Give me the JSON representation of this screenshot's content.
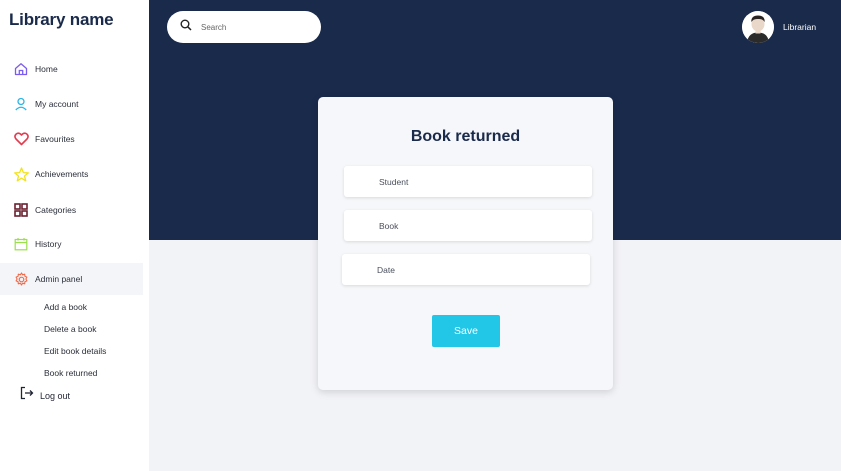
{
  "sidebar": {
    "brand": "Library name",
    "items": [
      {
        "label": "Home",
        "icon": "home-icon",
        "color": "#7b5cf0"
      },
      {
        "label": "My account",
        "icon": "user-icon",
        "color": "#2fb5e8"
      },
      {
        "label": "Favourites",
        "icon": "heart-icon",
        "color": "#e43b4f"
      },
      {
        "label": "Achievements",
        "icon": "star-icon",
        "color": "#f2e21b"
      },
      {
        "label": "Categories",
        "icon": "grid-icon",
        "color": "#6b1f2f"
      },
      {
        "label": "History",
        "icon": "calendar-icon",
        "color": "#9be04d"
      },
      {
        "label": "Admin panel",
        "icon": "gear-icon",
        "color": "#f06a4a"
      }
    ],
    "admin_subitems": [
      "Add a book",
      "Delete a book",
      "Edit book details",
      "Book returned"
    ],
    "logout": "Log out"
  },
  "header": {
    "search_placeholder": "Search",
    "user_name": "Librarian"
  },
  "form": {
    "title": "Book returned",
    "fields": [
      {
        "placeholder": "Student"
      },
      {
        "placeholder": "Book"
      },
      {
        "placeholder": "Date"
      }
    ],
    "save_label": "Save"
  },
  "colors": {
    "navy": "#1a2a4b",
    "accent": "#22c7e8",
    "page_bg": "#f2f3f7"
  }
}
